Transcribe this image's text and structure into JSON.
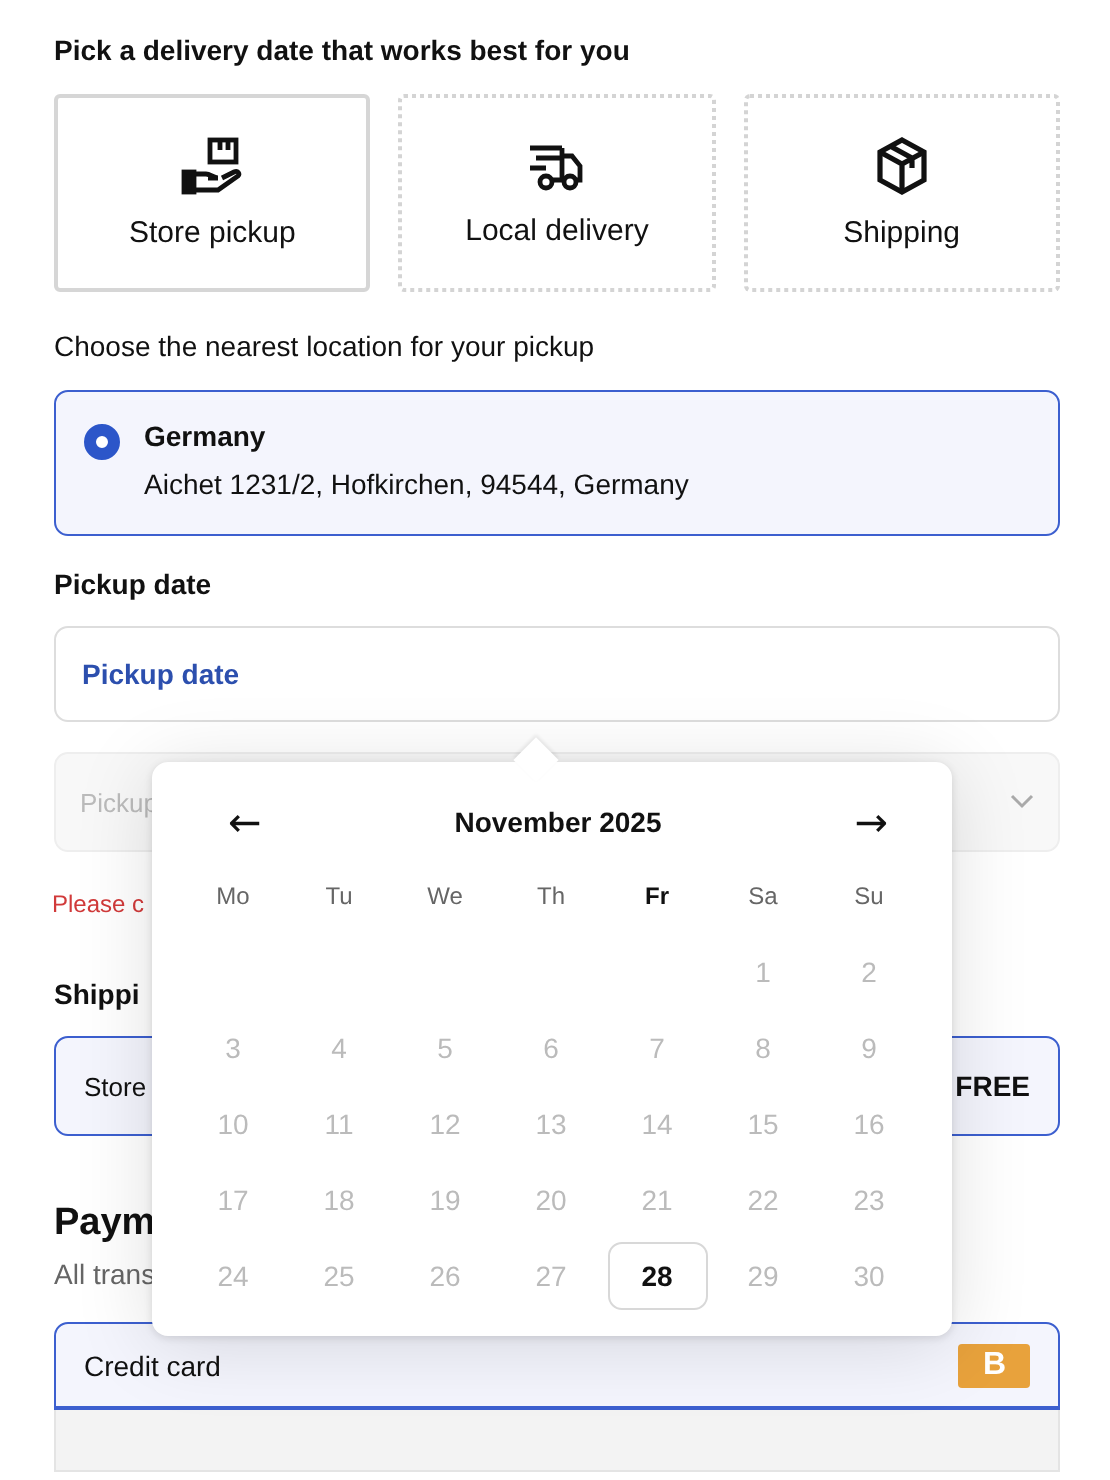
{
  "delivery": {
    "heading": "Pick a delivery date that works best for you",
    "options": [
      {
        "kind": "pickup",
        "label": "Store pickup",
        "selected": true
      },
      {
        "kind": "truck",
        "label": "Local delivery",
        "selected": false
      },
      {
        "kind": "box",
        "label": "Shipping",
        "selected": false
      }
    ]
  },
  "location": {
    "heading": "Choose the nearest location for your pickup",
    "name": "Germany",
    "address": "Aichet 1231/2, Hofkirchen, 94544, Germany",
    "selected": true
  },
  "pickup_date": {
    "heading": "Pickup date",
    "label": "Pickup date"
  },
  "time_select": {
    "placeholder": "Pickup",
    "disabled": true
  },
  "error": "Please c",
  "shipping": {
    "heading": "Shippi",
    "method": "Store",
    "price": "FREE"
  },
  "payment": {
    "heading": "Paym",
    "subtitle": "All trans",
    "method": "Credit card",
    "badge": "B"
  },
  "calendar": {
    "prev": "←",
    "month": "November 2025",
    "next": "→",
    "weekdays": [
      {
        "label": "Mo",
        "current": false
      },
      {
        "label": "Tu",
        "current": false
      },
      {
        "label": "We",
        "current": false
      },
      {
        "label": "Th",
        "current": false
      },
      {
        "label": "Fr",
        "current": true
      },
      {
        "label": "Sa",
        "current": false
      },
      {
        "label": "Su",
        "current": false
      }
    ],
    "weeks": [
      [
        {
          "kind": "blank"
        },
        {
          "kind": "blank"
        },
        {
          "kind": "blank"
        },
        {
          "kind": "blank"
        },
        {
          "kind": "blank"
        },
        {
          "kind": "day",
          "label": "1",
          "disabled": true,
          "selected": false
        },
        {
          "kind": "day",
          "label": "2",
          "disabled": true,
          "selected": false
        }
      ],
      [
        {
          "kind": "day",
          "label": "3",
          "disabled": true,
          "selected": false
        },
        {
          "kind": "day",
          "label": "4",
          "disabled": true,
          "selected": false
        },
        {
          "kind": "day",
          "label": "5",
          "disabled": true,
          "selected": false
        },
        {
          "kind": "day",
          "label": "6",
          "disabled": true,
          "selected": false
        },
        {
          "kind": "day",
          "label": "7",
          "disabled": true,
          "selected": false
        },
        {
          "kind": "day",
          "label": "8",
          "disabled": true,
          "selected": false
        },
        {
          "kind": "day",
          "label": "9",
          "disabled": true,
          "selected": false
        }
      ],
      [
        {
          "kind": "day",
          "label": "10",
          "disabled": true,
          "selected": false
        },
        {
          "kind": "day",
          "label": "11",
          "disabled": true,
          "selected": false
        },
        {
          "kind": "day",
          "label": "12",
          "disabled": true,
          "selected": false
        },
        {
          "kind": "day",
          "label": "13",
          "disabled": true,
          "selected": false
        },
        {
          "kind": "day",
          "label": "14",
          "disabled": true,
          "selected": false
        },
        {
          "kind": "day",
          "label": "15",
          "disabled": true,
          "selected": false
        },
        {
          "kind": "day",
          "label": "16",
          "disabled": true,
          "selected": false
        }
      ],
      [
        {
          "kind": "day",
          "label": "17",
          "disabled": true,
          "selected": false
        },
        {
          "kind": "day",
          "label": "18",
          "disabled": true,
          "selected": false
        },
        {
          "kind": "day",
          "label": "19",
          "disabled": true,
          "selected": false
        },
        {
          "kind": "day",
          "label": "20",
          "disabled": true,
          "selected": false
        },
        {
          "kind": "day",
          "label": "21",
          "disabled": true,
          "selected": false
        },
        {
          "kind": "day",
          "label": "22",
          "disabled": true,
          "selected": false
        },
        {
          "kind": "day",
          "label": "23",
          "disabled": true,
          "selected": false
        }
      ],
      [
        {
          "kind": "day",
          "label": "24",
          "disabled": true,
          "selected": false
        },
        {
          "kind": "day",
          "label": "25",
          "disabled": true,
          "selected": false
        },
        {
          "kind": "day",
          "label": "26",
          "disabled": true,
          "selected": false
        },
        {
          "kind": "day",
          "label": "27",
          "disabled": true,
          "selected": false
        },
        {
          "kind": "day",
          "label": "28",
          "disabled": false,
          "selected": true
        },
        {
          "kind": "day",
          "label": "29",
          "disabled": true,
          "selected": false
        },
        {
          "kind": "day",
          "label": "30",
          "disabled": true,
          "selected": false
        }
      ]
    ]
  }
}
